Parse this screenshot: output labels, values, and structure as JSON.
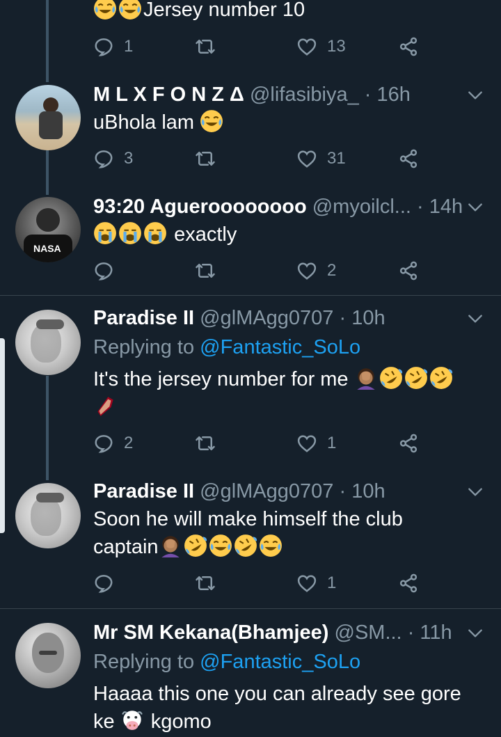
{
  "tweets": [
    {
      "text_lines": [
        "Jersey number 10"
      ],
      "replies": "1",
      "likes": "13"
    },
    {
      "name": "M L X F O N Z Δ",
      "handle": "@lifasibiya_",
      "time": "· 16h",
      "text_lines": [
        "uBhola lam"
      ],
      "replies": "3",
      "likes": "31"
    },
    {
      "name": "93:20 Agueroooooooo",
      "handle": "@myoilcl...",
      "time": "· 14h",
      "text_lines": [
        "exactly"
      ],
      "replies": "",
      "likes": "2"
    },
    {
      "name": "Paradise II",
      "handle": "@glMAgg0707",
      "time": "· 10h",
      "replying_label": "Replying to",
      "replying_to": "@Fantastic_SoLo",
      "text_lines": [
        "It's the jersey number for me"
      ],
      "replies": "2",
      "likes": "1"
    },
    {
      "name": "Paradise II",
      "handle": "@glMAgg0707",
      "time": "· 10h",
      "text_lines": [
        "Soon he will make himself the club",
        "captain"
      ],
      "replies": "",
      "likes": "1"
    },
    {
      "name": "Mr SM Kekana(Bhamjee)",
      "handle": "@SM...",
      "time": "· 11h",
      "replying_label": "Replying to",
      "replying_to": "@Fantastic_SoLo",
      "text_lines": [
        "Haaaa this one you can already see gore",
        "ke",
        "kgomo"
      ]
    }
  ],
  "icons": {
    "reply": "reply-bubble-icon",
    "retweet": "retweet-icon",
    "like": "heart-icon",
    "share": "share-icon",
    "caret": "chevron-down-icon"
  },
  "colors": {
    "background": "#15202b",
    "secondary_text": "#8899a6",
    "link": "#1da1f2",
    "separator": "#38444d"
  }
}
